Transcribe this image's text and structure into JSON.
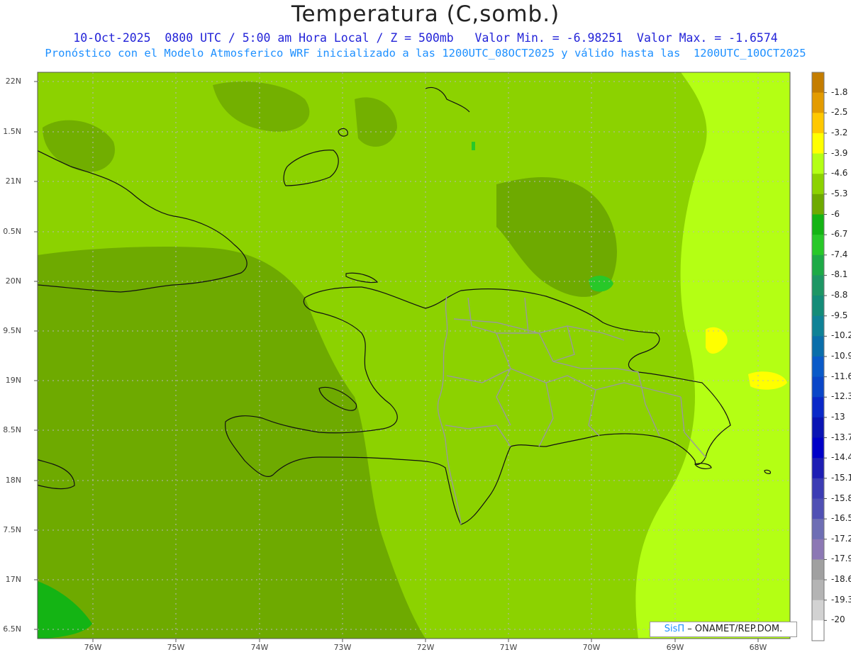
{
  "header": {
    "title": "Temperatura (C,somb.)",
    "subtitle1": "10-Oct-2025  0800 UTC / 5:00 am Hora Local / Z = 500mb   Valor Min. = -6.98251  Valor Max. = -1.6574",
    "subtitle2": "Pronóstico con el Modelo Atmosferico WRF inicializado a las 1200UTC_08OCT2025 y válido hasta las  1200UTC_10OCT2025"
  },
  "axes": {
    "lat_labels": [
      "22N",
      "1.5N",
      "21N",
      "0.5N",
      "20N",
      "9.5N",
      "19N",
      "8.5N",
      "18N",
      "7.5N",
      "17N",
      "6.5N"
    ],
    "lon_labels": [
      "76W",
      "75W",
      "74W",
      "73W",
      "72W",
      "71W",
      "70W",
      "69W",
      "68W"
    ]
  },
  "colorbar": {
    "labels": [
      "-1.8",
      "-2.5",
      "-3.2",
      "-3.9",
      "-4.6",
      "-5.3",
      "-6",
      "-6.7",
      "-7.4",
      "-8.1",
      "-8.8",
      "-9.5",
      "-10.2",
      "-10.9",
      "-11.6",
      "-12.3",
      "-13",
      "-13.7",
      "-14.4",
      "-15.1",
      "-15.8",
      "-16.5",
      "-17.2",
      "-17.9",
      "-18.6",
      "-19.3",
      "-20"
    ],
    "colors": [
      "#c47d00",
      "#e39b00",
      "#ffc800",
      "#ffff00",
      "#b4ff14",
      "#8cd200",
      "#6eaa00",
      "#14b414",
      "#28c828",
      "#1eaa46",
      "#1e9664",
      "#148c78",
      "#0f8296",
      "#0a6eaa",
      "#0a5ac8",
      "#0a46c8",
      "#0a28c8",
      "#0a14b4",
      "#0000c8",
      "#1e1eb4",
      "#3c3cb4",
      "#5050b4",
      "#6e6eb4",
      "#8c78b4",
      "#a0a0a0",
      "#b4b4b4",
      "#d2d2d2",
      "#ffffff"
    ]
  },
  "credit": {
    "logo_text": "SisΠ",
    "text": " – ONAMET/REP.DOM."
  }
}
